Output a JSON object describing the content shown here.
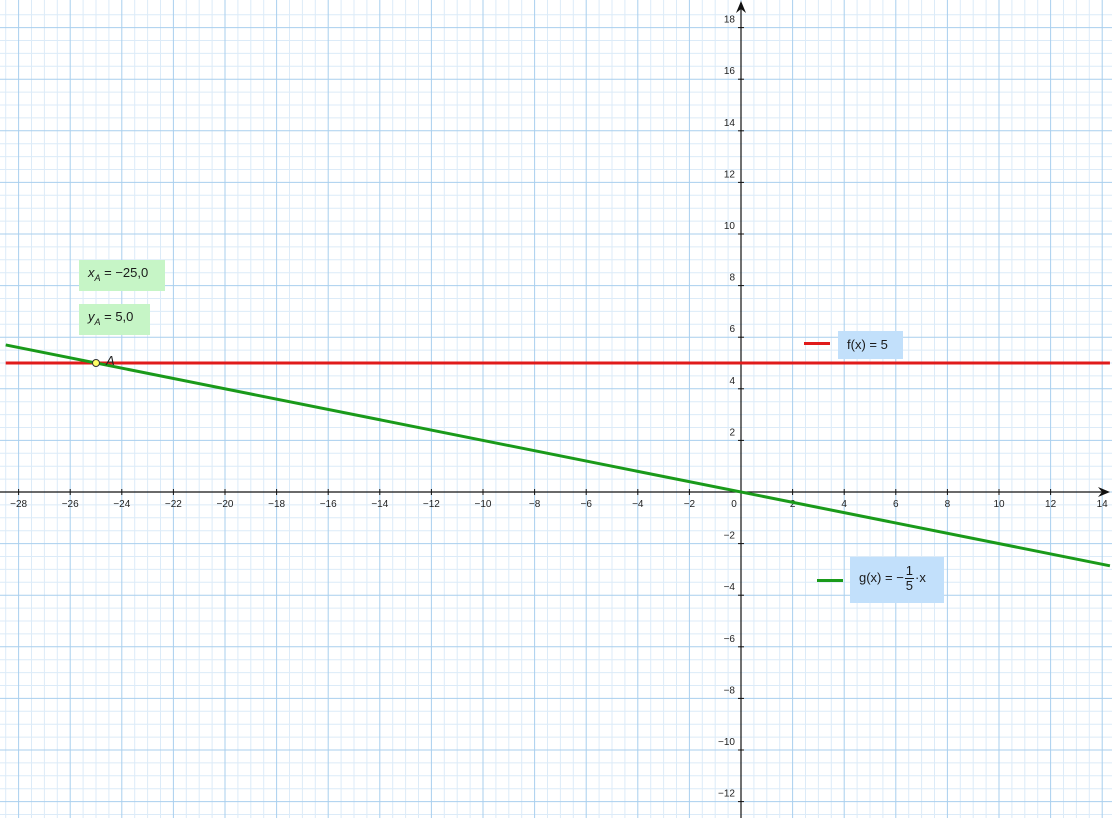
{
  "chart_data": {
    "type": "line",
    "x_ticks": [
      "−28",
      "−26",
      "−24",
      "−22",
      "−20",
      "−18",
      "−16",
      "−14",
      "−12",
      "−10",
      "−8",
      "−6",
      "−4",
      "−2",
      "0",
      "2",
      "4",
      "6",
      "8",
      "10",
      "12",
      "14"
    ],
    "y_ticks": [
      "−12",
      "−10",
      "−8",
      "−6",
      "−4",
      "−2",
      "2",
      "4",
      "6",
      "8",
      "10",
      "12",
      "14",
      "16",
      "18"
    ],
    "xlim": [
      -28.5,
      14.3
    ],
    "ylim": [
      -12.7,
      18.8
    ],
    "grid": true,
    "series": [
      {
        "name": "f",
        "label": "f(x) = 5",
        "color": "#e01b1b",
        "expr": "5",
        "points": [
          [
            -28.5,
            5
          ],
          [
            14.3,
            5
          ]
        ]
      },
      {
        "name": "g",
        "label_prefix": "g(x) = −",
        "frac_num": "1",
        "frac_den": "5",
        "label_suffix": "·x",
        "color": "#1a9a1a",
        "expr": "-1/5*x",
        "points": [
          [
            -28.5,
            5.7
          ],
          [
            14.3,
            -2.86
          ]
        ]
      }
    ],
    "point": {
      "name": "A",
      "x": -25.0,
      "y": 5.0
    },
    "readouts": {
      "xA_var": "x",
      "xA_sub": "A",
      "xA_text": " = −25,0",
      "yA_var": "y",
      "yA_sub": "A",
      "yA_text": " = 5,0"
    }
  },
  "colors": {
    "grid_major": "#a9cfee",
    "grid_minor": "#dcebf8",
    "axis": "#111111",
    "f": "#e01b1b",
    "g": "#1a9a1a"
  }
}
